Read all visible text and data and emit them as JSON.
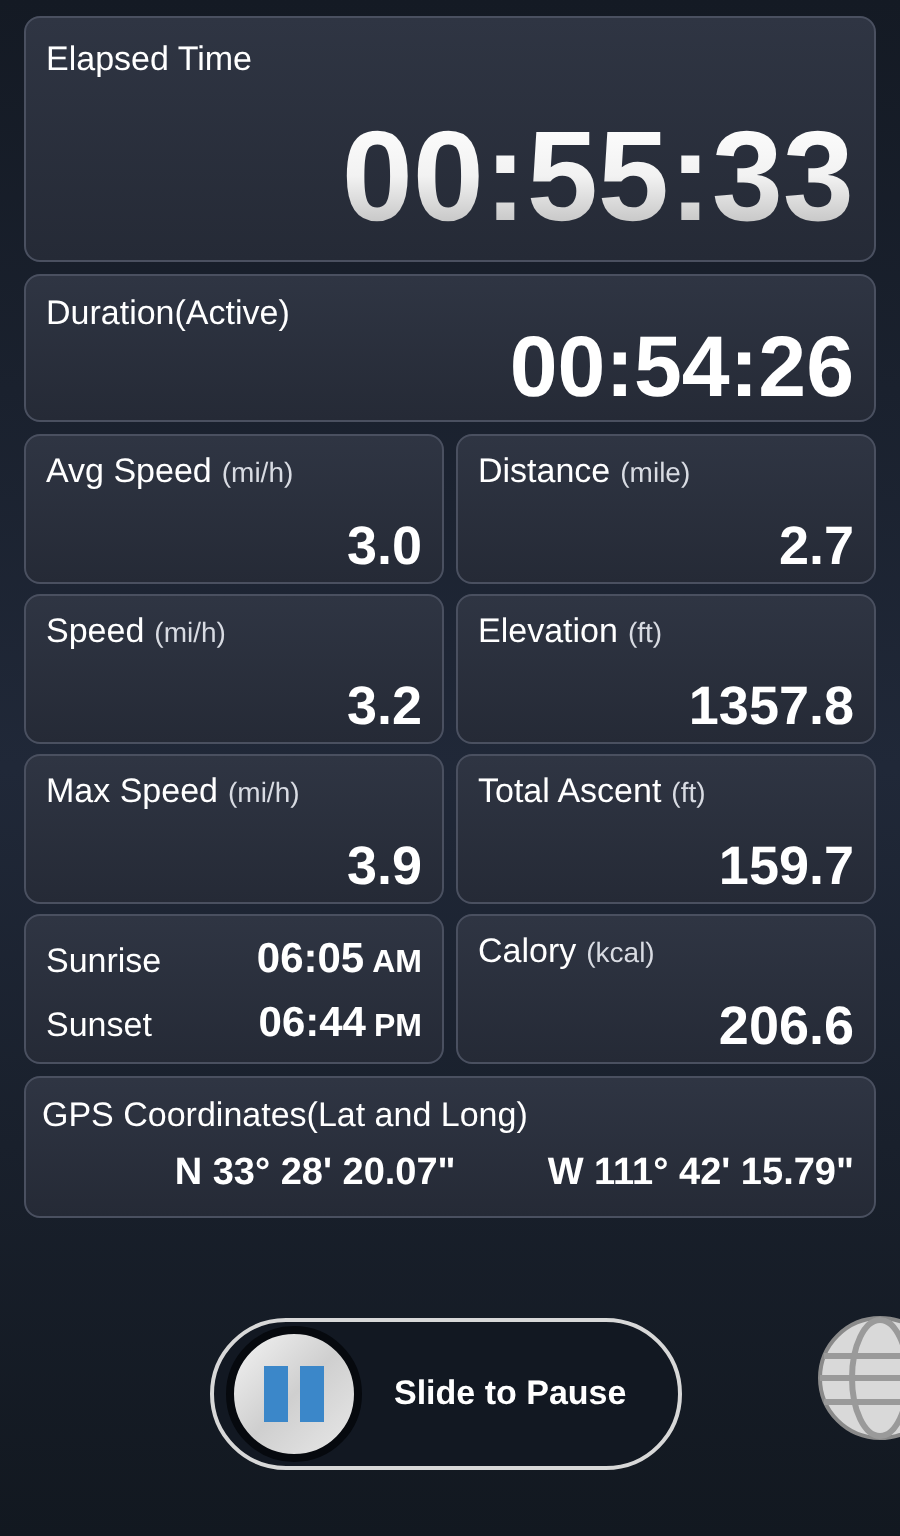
{
  "elapsed": {
    "label": "Elapsed Time",
    "value": "00:55:33"
  },
  "duration": {
    "label": "Duration(Active)",
    "value": "00:54:26"
  },
  "tiles": [
    {
      "kind": "stat",
      "label": "Avg Speed",
      "unit": "(mi/h)",
      "value": "3.0"
    },
    {
      "kind": "stat",
      "label": "Distance",
      "unit": "(mile)",
      "value": "2.7"
    },
    {
      "kind": "stat",
      "label": "Speed",
      "unit": "(mi/h)",
      "value": "3.2"
    },
    {
      "kind": "stat",
      "label": "Elevation",
      "unit": "(ft)",
      "value": "1357.8"
    },
    {
      "kind": "stat",
      "label": "Max Speed",
      "unit": "(mi/h)",
      "value": "3.9"
    },
    {
      "kind": "stat",
      "label": "Total Ascent",
      "unit": "(ft)",
      "value": "159.7"
    },
    {
      "kind": "sun",
      "rows": [
        {
          "label": "Sunrise",
          "time": "06:05",
          "suffix": "AM"
        },
        {
          "label": "Sunset",
          "time": "06:44",
          "suffix": "PM"
        }
      ]
    },
    {
      "kind": "stat",
      "label": "Calory",
      "unit": "(kcal)",
      "value": "206.6"
    }
  ],
  "gps": {
    "label": "GPS Coordinates(Lat and Long)",
    "latitude": "N 33° 28' 20.07\"",
    "longitude": "W 111° 42' 15.79\""
  },
  "slider": {
    "label": "Slide to Pause",
    "level": 0
  }
}
